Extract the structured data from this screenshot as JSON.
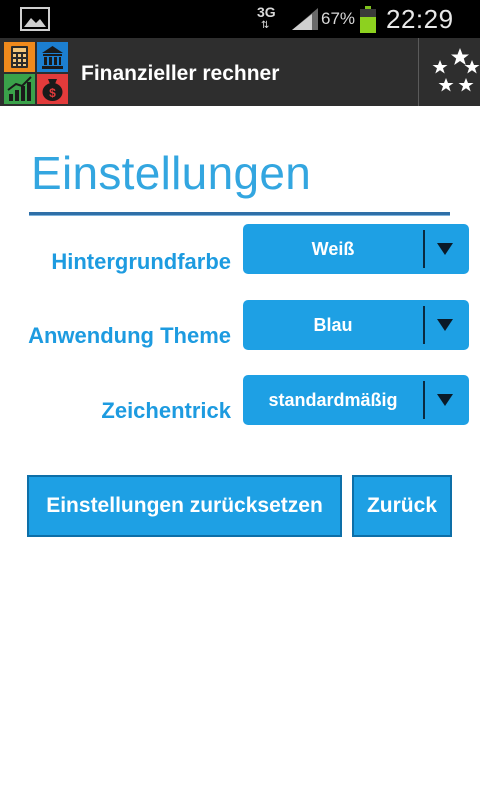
{
  "status_bar": {
    "network": "3G",
    "battery_percent": "67%",
    "time": "22:29",
    "icons": [
      "gallery-icon",
      "data-arrows-icon",
      "signal-icon",
      "battery-icon"
    ]
  },
  "app_bar": {
    "title": "Finanzieller rechner",
    "logo_icons": [
      "calculator-icon",
      "bank-icon",
      "chart-icon",
      "money-bag-icon"
    ],
    "rate_icon": "stars-icon"
  },
  "page": {
    "title": "Einstellungen"
  },
  "settings": {
    "background": {
      "label": "Hintergrundfarbe",
      "value": "Weiß"
    },
    "theme": {
      "label": "Anwendung Theme",
      "value": "Blau"
    },
    "animation": {
      "label": "Zeichentrick",
      "value": "standardmäßig"
    }
  },
  "buttons": {
    "reset_label": "Einstellungen zurücksetzen",
    "back_label": "Zurück"
  },
  "colors": {
    "accent": "#1ea0e4",
    "title": "#33a6e0",
    "app_bar": "#2e2e2e",
    "status_bar": "#000000"
  }
}
